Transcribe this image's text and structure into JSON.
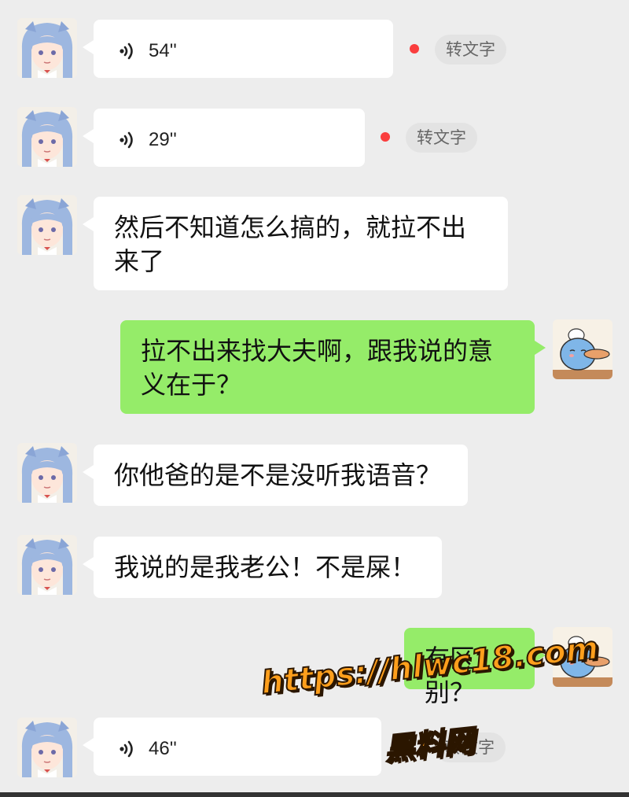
{
  "colors": {
    "background": "#ededed",
    "incoming_bubble": "#ffffff",
    "outgoing_bubble": "#95ec69",
    "unread_dot": "#fa3e3e",
    "watermark": "#ff9f1c"
  },
  "messages": [
    {
      "type": "voice",
      "direction": "incoming",
      "duration": "54''",
      "convert_label": "转文字",
      "unread": true
    },
    {
      "type": "voice",
      "direction": "incoming",
      "duration": "29''",
      "convert_label": "转文字",
      "unread": true
    },
    {
      "type": "text",
      "direction": "incoming",
      "text": "然后不知道怎么搞的，就拉不出来了"
    },
    {
      "type": "text",
      "direction": "outgoing",
      "text": "拉不出来找大夫啊，跟我说的意义在于？"
    },
    {
      "type": "text",
      "direction": "incoming",
      "text": "你他爸的是不是没听我语音？"
    },
    {
      "type": "text",
      "direction": "incoming",
      "text": "我说的是我老公！不是屎！"
    },
    {
      "type": "text",
      "direction": "outgoing",
      "text": "有区别？"
    },
    {
      "type": "voice",
      "direction": "incoming",
      "duration": "46''",
      "convert_label": "转文字"
    }
  ],
  "line_breaks": {
    "msg2": "然后不知道怎么搞的，就拉不出\n来了",
    "msg3": "拉不出来找大夫啊，跟我说的意\n义在于？"
  },
  "watermark": {
    "line1": "https://hlwc18.com",
    "line2": "黑料网"
  }
}
